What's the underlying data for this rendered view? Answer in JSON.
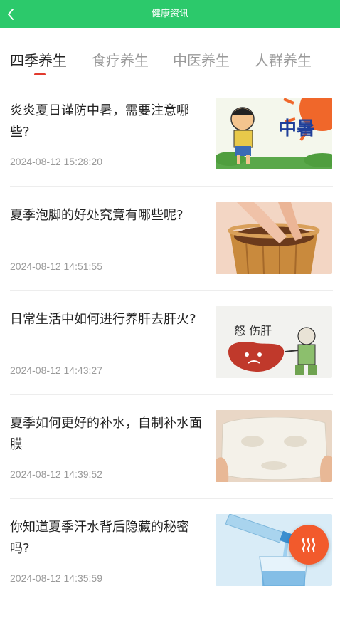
{
  "header": {
    "title": "健康资讯",
    "back_icon": "chevron-left-icon"
  },
  "tabs": [
    {
      "label": "四季养生",
      "active": true
    },
    {
      "label": "食疗养生",
      "active": false
    },
    {
      "label": "中医养生",
      "active": false
    },
    {
      "label": "人群养生",
      "active": false
    }
  ],
  "articles": [
    {
      "title": "炎炎夏日谨防中暑，需要注意哪些?",
      "time": "2024-08-12 15:28:20",
      "thumb_text": "中暑"
    },
    {
      "title": "夏季泡脚的好处究竟有哪些呢?",
      "time": "2024-08-12 14:51:55"
    },
    {
      "title": "日常生活中如何进行养肝去肝火?",
      "time": "2024-08-12 14:43:27",
      "thumb_text": "怒 伤肝"
    },
    {
      "title": "夏季如何更好的补水，自制补水面膜",
      "time": "2024-08-12 14:39:52"
    },
    {
      "title": "你知道夏季汗水背后隐藏的秘密吗?",
      "time": "2024-08-12 14:35:59"
    }
  ],
  "fab": {
    "icon": "heat-waves-icon",
    "color": "#f25a2c"
  },
  "colors": {
    "header": "#2cc96b",
    "indicator": "#e23b2e"
  }
}
